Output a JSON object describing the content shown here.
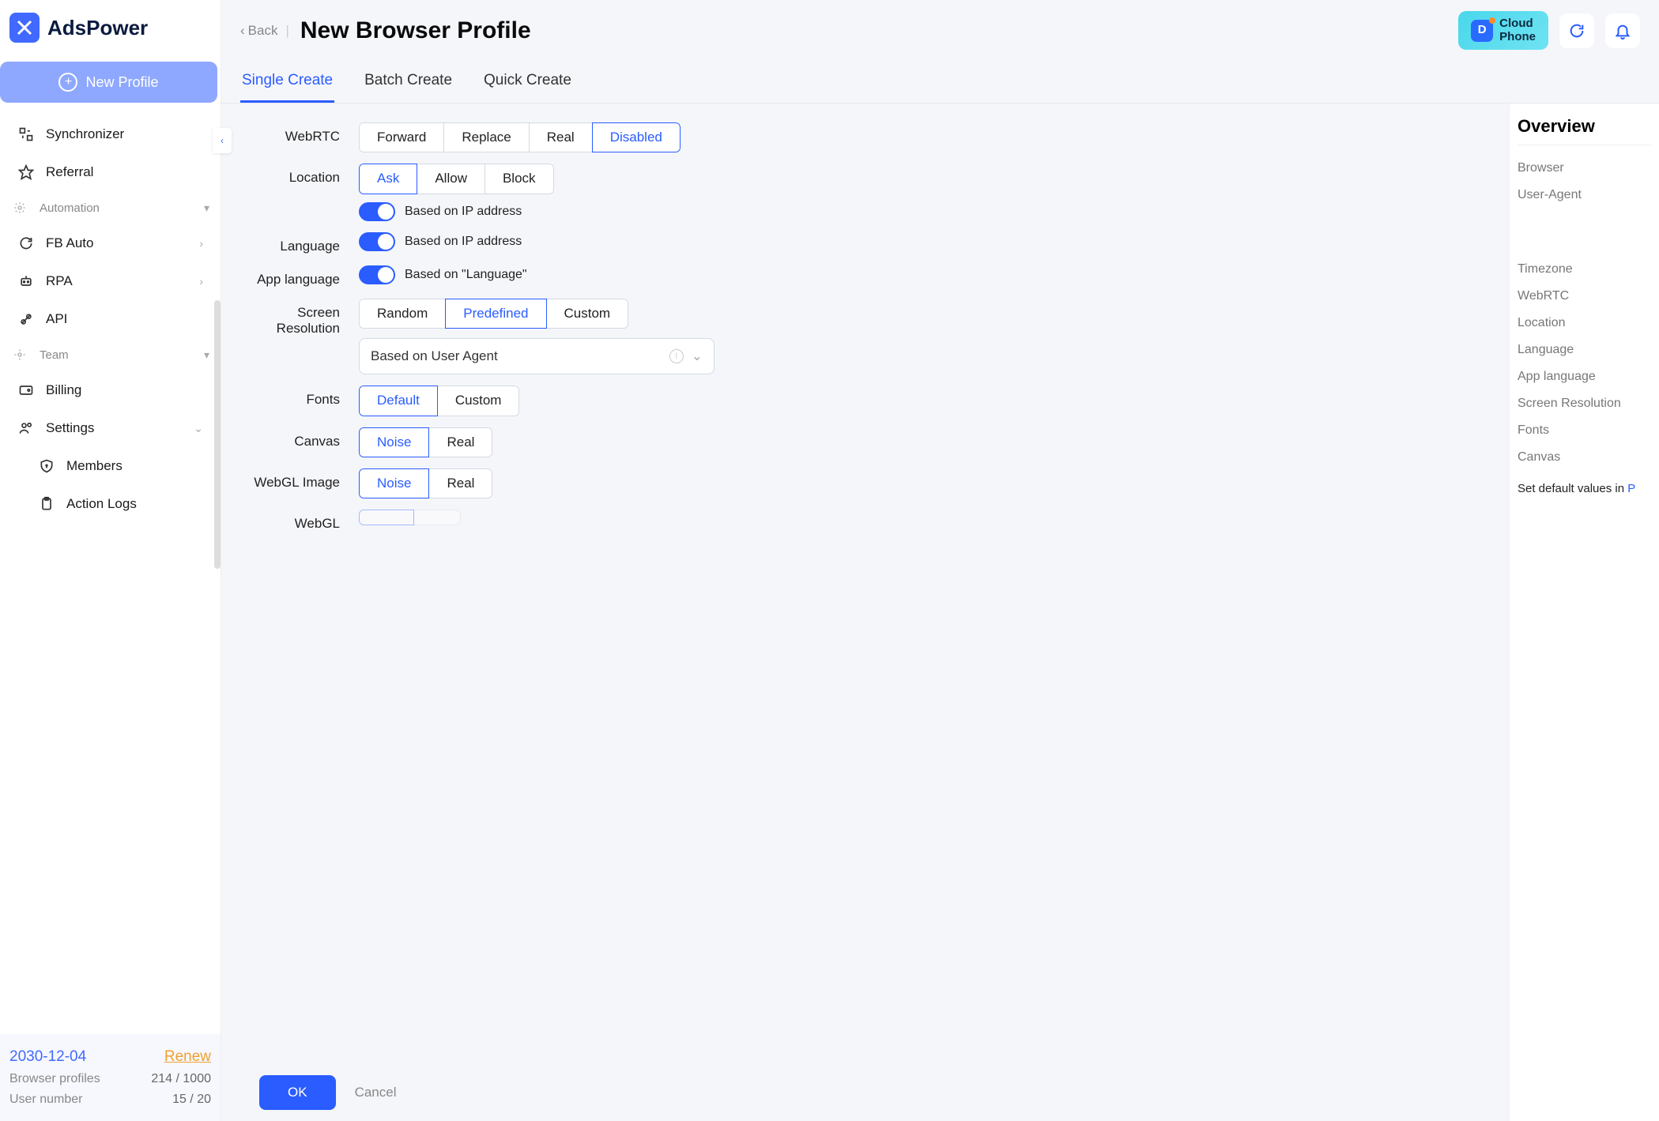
{
  "app": {
    "name": "AdsPower"
  },
  "sidebar": {
    "new_profile": "New Profile",
    "items": {
      "synchronizer": "Synchronizer",
      "referral": "Referral",
      "automation": "Automation",
      "fb_auto": "FB Auto",
      "rpa": "RPA",
      "api": "API",
      "team": "Team",
      "billing": "Billing",
      "settings": "Settings",
      "members": "Members",
      "action_logs": "Action Logs"
    },
    "footer": {
      "date": "2030-12-04",
      "renew": "Renew",
      "profiles_label": "Browser profiles",
      "profiles_value": "214 / 1000",
      "users_label": "User number",
      "users_value": "15 / 20"
    }
  },
  "header": {
    "back": "Back",
    "title": "New Browser Profile",
    "cloud_phone": "Cloud\nPhone"
  },
  "tabs": {
    "single": "Single Create",
    "batch": "Batch Create",
    "quick": "Quick Create"
  },
  "form": {
    "webrtc": {
      "label": "WebRTC",
      "options": [
        "Forward",
        "Replace",
        "Real",
        "Disabled"
      ],
      "active": 3
    },
    "location": {
      "label": "Location",
      "options": [
        "Ask",
        "Allow",
        "Block"
      ],
      "active": 0,
      "toggle_text": "Based on IP address"
    },
    "language": {
      "label": "Language",
      "toggle_text": "Based on IP address"
    },
    "app_language": {
      "label": "App language",
      "toggle_text": "Based on \"Language\""
    },
    "screen_res": {
      "label": "Screen Resolution",
      "options": [
        "Random",
        "Predefined",
        "Custom"
      ],
      "active": 1,
      "select_value": "Based on User Agent"
    },
    "fonts": {
      "label": "Fonts",
      "options": [
        "Default",
        "Custom"
      ],
      "active": 0
    },
    "canvas": {
      "label": "Canvas",
      "options": [
        "Noise",
        "Real"
      ],
      "active": 0
    },
    "webgl_image": {
      "label": "WebGL Image",
      "options": [
        "Noise",
        "Real"
      ],
      "active": 0
    },
    "webgl": {
      "label": "WebGL"
    }
  },
  "overview": {
    "title": "Overview",
    "items_top": [
      "Browser",
      "User-Agent"
    ],
    "items": [
      "Timezone",
      "WebRTC",
      "Location",
      "Language",
      "App language",
      "Screen Resolution",
      "Fonts",
      "Canvas"
    ],
    "footer_prefix": "Set default values in ",
    "footer_link": "P"
  },
  "actions": {
    "ok": "OK",
    "cancel": "Cancel"
  }
}
